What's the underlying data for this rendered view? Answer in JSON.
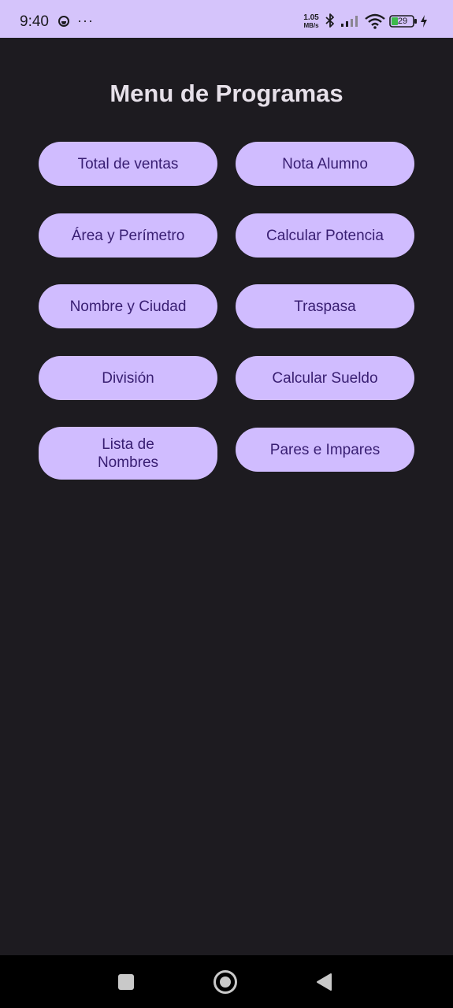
{
  "status_bar": {
    "time": "9:40",
    "more": "···",
    "speed_value": "1.05",
    "speed_unit": "MB/s",
    "battery": "29",
    "colors": {
      "background": "#d5c4fb",
      "foreground": "#1c1b1f",
      "battery_fill": "#3dbb4a"
    }
  },
  "main": {
    "title": "Menu de Programas",
    "buttons": [
      {
        "label": "Total de ventas"
      },
      {
        "label": "Nota Alumno"
      },
      {
        "label": "Área y Perímetro"
      },
      {
        "label": "Calcular Potencia"
      },
      {
        "label": "Nombre y Ciudad"
      },
      {
        "label": "Traspasa"
      },
      {
        "label": "División"
      },
      {
        "label": "Calcular Sueldo"
      },
      {
        "label": "Lista de Nombres"
      },
      {
        "label": "Pares e Impares"
      }
    ],
    "colors": {
      "background": "#1d1b20",
      "title": "#e6e0e9",
      "button_bg": "#d0bcff",
      "button_text": "#381e72"
    }
  },
  "nav_bar": {
    "icons": [
      "recents-square-icon",
      "home-circle-icon",
      "back-triangle-icon"
    ],
    "colors": {
      "background": "#000000",
      "icon": "#c9c9c9"
    }
  }
}
